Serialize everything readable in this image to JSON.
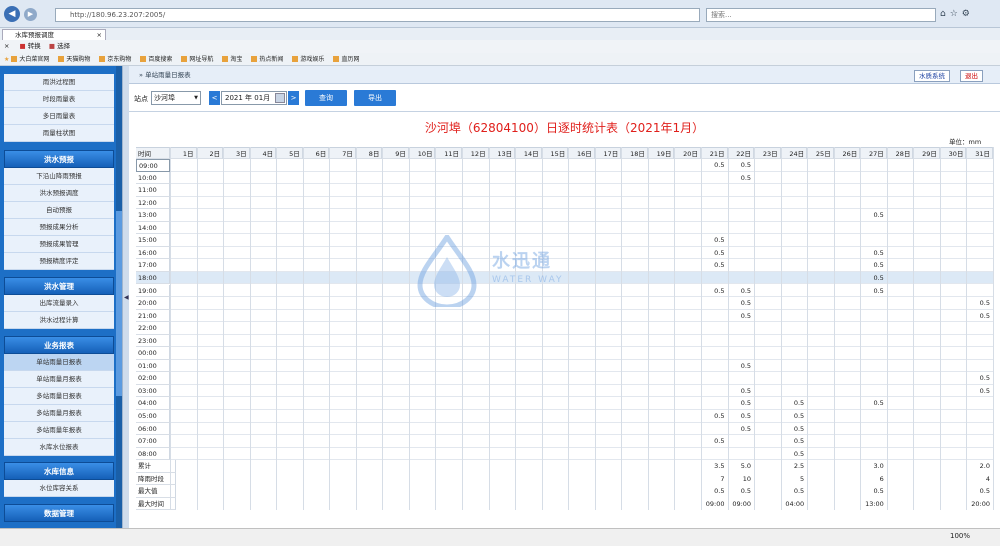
{
  "browser": {
    "url": "http://180.96.23.207:2005/",
    "search_placeholder": "搜索...",
    "tab_title": "水库预报调度",
    "cmd": [
      "转换",
      "选择"
    ],
    "favorites": [
      "大白菜官网",
      "天猫购物",
      "京东购物",
      "百度搜索",
      "网址导航",
      "淘宝",
      "热点新闻",
      "游戏娱乐",
      "直历网"
    ],
    "zoom": "100%"
  },
  "sidebar": {
    "groups": [
      {
        "items": [
          "雨洪过程图",
          "时段雨量表",
          "多日雨量表",
          "雨量柱状图"
        ]
      },
      {
        "title": "洪水预报",
        "items": [
          "下沿山降雨预报",
          "洪水预报调度",
          "自动预报",
          "预报成果分析",
          "预报成果管理",
          "预报精度评定"
        ]
      },
      {
        "title": "洪水管理",
        "items": [
          "出库流量录入",
          "洪水过程计算"
        ]
      },
      {
        "title": "业务报表",
        "items": [
          "单站雨量日报表",
          "单站雨量月报表",
          "多站雨量日报表",
          "多站雨量月报表",
          "多站雨量年报表",
          "水库水位报表"
        ]
      },
      {
        "title": "水库信息",
        "items": [
          "水位库容关系"
        ]
      },
      {
        "title": "数据管理",
        "items": []
      }
    ]
  },
  "main": {
    "breadcrumb": "单站雨量日报表",
    "btn_system": "水质系统",
    "btn_exit": "退出",
    "station_label": "站点",
    "station": "沙河埠",
    "date": "2021 年  01月",
    "query": "查询",
    "export": "导出",
    "title": "沙河埠（62804100）日逐时统计表（2021年1月）",
    "unit": "单位：mm"
  },
  "watermark": {
    "name": "水迅通",
    "sub": "WATER WAY"
  },
  "table": {
    "time_header": "时间",
    "days": [
      "1日",
      "2日",
      "3日",
      "4日",
      "5日",
      "6日",
      "7日",
      "8日",
      "9日",
      "10日",
      "11日",
      "12日",
      "13日",
      "14日",
      "15日",
      "16日",
      "17日",
      "18日",
      "19日",
      "20日",
      "21日",
      "22日",
      "23日",
      "24日",
      "25日",
      "26日",
      "27日",
      "28日",
      "29日",
      "30日",
      "31日"
    ],
    "hours": [
      "09:00",
      "10:00",
      "11:00",
      "12:00",
      "13:00",
      "14:00",
      "15:00",
      "16:00",
      "17:00",
      "18:00",
      "19:00",
      "20:00",
      "21:00",
      "22:00",
      "23:00",
      "00:00",
      "01:00",
      "02:00",
      "03:00",
      "04:00",
      "05:00",
      "06:00",
      "07:00",
      "08:00"
    ],
    "values": [
      [
        "",
        "",
        "",
        "",
        "",
        "",
        "",
        "",
        "",
        "",
        "",
        "",
        "",
        "",
        "",
        "",
        "",
        "",
        "",
        "",
        "0.5",
        "0.5",
        "",
        "",
        "",
        "",
        "",
        "",
        "",
        "",
        ""
      ],
      [
        "",
        "",
        "",
        "",
        "",
        "",
        "",
        "",
        "",
        "",
        "",
        "",
        "",
        "",
        "",
        "",
        "",
        "",
        "",
        "",
        "",
        "0.5",
        "",
        "",
        "",
        "",
        "",
        "",
        "",
        "",
        ""
      ],
      [
        "",
        "",
        "",
        "",
        "",
        "",
        "",
        "",
        "",
        "",
        "",
        "",
        "",
        "",
        "",
        "",
        "",
        "",
        "",
        "",
        "",
        "",
        "",
        "",
        "",
        "",
        "",
        "",
        "",
        "",
        ""
      ],
      [
        "",
        "",
        "",
        "",
        "",
        "",
        "",
        "",
        "",
        "",
        "",
        "",
        "",
        "",
        "",
        "",
        "",
        "",
        "",
        "",
        "",
        "",
        "",
        "",
        "",
        "",
        "",
        "",
        "",
        "",
        ""
      ],
      [
        "",
        "",
        "",
        "",
        "",
        "",
        "",
        "",
        "",
        "",
        "",
        "",
        "",
        "",
        "",
        "",
        "",
        "",
        "",
        "",
        "",
        "",
        "",
        "",
        "",
        "",
        "0.5",
        "",
        "",
        "",
        ""
      ],
      [
        "",
        "",
        "",
        "",
        "",
        "",
        "",
        "",
        "",
        "",
        "",
        "",
        "",
        "",
        "",
        "",
        "",
        "",
        "",
        "",
        "",
        "",
        "",
        "",
        "",
        "",
        "",
        "",
        "",
        "",
        ""
      ],
      [
        "",
        "",
        "",
        "",
        "",
        "",
        "",
        "",
        "",
        "",
        "",
        "",
        "",
        "",
        "",
        "",
        "",
        "",
        "",
        "",
        "0.5",
        "",
        "",
        "",
        "",
        "",
        "",
        "",
        "",
        "",
        ""
      ],
      [
        "",
        "",
        "",
        "",
        "",
        "",
        "",
        "",
        "",
        "",
        "",
        "",
        "",
        "",
        "",
        "",
        "",
        "",
        "",
        "",
        "0.5",
        "",
        "",
        "",
        "",
        "",
        "0.5",
        "",
        "",
        "",
        ""
      ],
      [
        "",
        "",
        "",
        "",
        "",
        "",
        "",
        "",
        "",
        "",
        "",
        "",
        "",
        "",
        "",
        "",
        "",
        "",
        "",
        "",
        "0.5",
        "",
        "",
        "",
        "",
        "",
        "0.5",
        "",
        "",
        "",
        ""
      ],
      [
        "",
        "",
        "",
        "",
        "",
        "",
        "",
        "",
        "",
        "",
        "",
        "",
        "",
        "",
        "",
        "",
        "",
        "",
        "",
        "",
        "",
        "",
        "",
        "",
        "",
        "",
        "0.5",
        "",
        "",
        "",
        ""
      ],
      [
        "",
        "",
        "",
        "",
        "",
        "",
        "",
        "",
        "",
        "",
        "",
        "",
        "",
        "",
        "",
        "",
        "",
        "",
        "",
        "",
        "0.5",
        "0.5",
        "",
        "",
        "",
        "",
        "0.5",
        "",
        "",
        "",
        ""
      ],
      [
        "",
        "",
        "",
        "",
        "",
        "",
        "",
        "",
        "",
        "",
        "",
        "",
        "",
        "",
        "",
        "",
        "",
        "",
        "",
        "",
        "",
        "0.5",
        "",
        "",
        "",
        "",
        "",
        "",
        "",
        "",
        "0.5"
      ],
      [
        "",
        "",
        "",
        "",
        "",
        "",
        "",
        "",
        "",
        "",
        "",
        "",
        "",
        "",
        "",
        "",
        "",
        "",
        "",
        "",
        "",
        "0.5",
        "",
        "",
        "",
        "",
        "",
        "",
        "",
        "",
        "0.5"
      ],
      [
        "",
        "",
        "",
        "",
        "",
        "",
        "",
        "",
        "",
        "",
        "",
        "",
        "",
        "",
        "",
        "",
        "",
        "",
        "",
        "",
        "",
        "",
        "",
        "",
        "",
        "",
        "",
        "",
        "",
        "",
        ""
      ],
      [
        "",
        "",
        "",
        "",
        "",
        "",
        "",
        "",
        "",
        "",
        "",
        "",
        "",
        "",
        "",
        "",
        "",
        "",
        "",
        "",
        "",
        "",
        "",
        "",
        "",
        "",
        "",
        "",
        "",
        "",
        ""
      ],
      [
        "",
        "",
        "",
        "",
        "",
        "",
        "",
        "",
        "",
        "",
        "",
        "",
        "",
        "",
        "",
        "",
        "",
        "",
        "",
        "",
        "",
        "",
        "",
        "",
        "",
        "",
        "",
        "",
        "",
        "",
        ""
      ],
      [
        "",
        "",
        "",
        "",
        "",
        "",
        "",
        "",
        "",
        "",
        "",
        "",
        "",
        "",
        "",
        "",
        "",
        "",
        "",
        "",
        "",
        "0.5",
        "",
        "",
        "",
        "",
        "",
        "",
        "",
        "",
        ""
      ],
      [
        "",
        "",
        "",
        "",
        "",
        "",
        "",
        "",
        "",
        "",
        "",
        "",
        "",
        "",
        "",
        "",
        "",
        "",
        "",
        "",
        "",
        "",
        "",
        "",
        "",
        "",
        "",
        "",
        "",
        "",
        "0.5"
      ],
      [
        "",
        "",
        "",
        "",
        "",
        "",
        "",
        "",
        "",
        "",
        "",
        "",
        "",
        "",
        "",
        "",
        "",
        "",
        "",
        "",
        "",
        "0.5",
        "",
        "",
        "",
        "",
        "",
        "",
        "",
        "",
        "0.5"
      ],
      [
        "",
        "",
        "",
        "",
        "",
        "",
        "",
        "",
        "",
        "",
        "",
        "",
        "",
        "",
        "",
        "",
        "",
        "",
        "",
        "",
        "",
        "0.5",
        "",
        "0.5",
        "",
        "",
        "0.5",
        "",
        "",
        "",
        ""
      ],
      [
        "",
        "",
        "",
        "",
        "",
        "",
        "",
        "",
        "",
        "",
        "",
        "",
        "",
        "",
        "",
        "",
        "",
        "",
        "",
        "",
        "0.5",
        "0.5",
        "",
        "0.5",
        "",
        "",
        "",
        "",
        "",
        "",
        ""
      ],
      [
        "",
        "",
        "",
        "",
        "",
        "",
        "",
        "",
        "",
        "",
        "",
        "",
        "",
        "",
        "",
        "",
        "",
        "",
        "",
        "",
        "",
        "0.5",
        "",
        "0.5",
        "",
        "",
        "",
        "",
        "",
        "",
        ""
      ],
      [
        "",
        "",
        "",
        "",
        "",
        "",
        "",
        "",
        "",
        "",
        "",
        "",
        "",
        "",
        "",
        "",
        "",
        "",
        "",
        "",
        "0.5",
        "",
        "",
        "0.5",
        "",
        "",
        "",
        "",
        "",
        "",
        ""
      ],
      [
        "",
        "",
        "",
        "",
        "",
        "",
        "",
        "",
        "",
        "",
        "",
        "",
        "",
        "",
        "",
        "",
        "",
        "",
        "",
        "",
        "",
        "",
        "",
        "0.5",
        "",
        "",
        "",
        "",
        "",
        "",
        ""
      ]
    ],
    "summary": [
      {
        "label": "累计",
        "values": {
          "21": "3.5",
          "22": "5.0",
          "24": "2.5",
          "27": "3.0",
          "31": "2.0"
        }
      },
      {
        "label": "降雨时段",
        "values": {
          "21": "7",
          "22": "10",
          "24": "5",
          "27": "6",
          "31": "4"
        }
      },
      {
        "label": "最大值",
        "values": {
          "21": "0.5",
          "22": "0.5",
          "24": "0.5",
          "27": "0.5",
          "31": "0.5"
        }
      },
      {
        "label": "最大时间",
        "values": {
          "21": "09:00",
          "22": "09:00",
          "24": "04:00",
          "27": "13:00",
          "31": "20:00"
        }
      }
    ]
  }
}
